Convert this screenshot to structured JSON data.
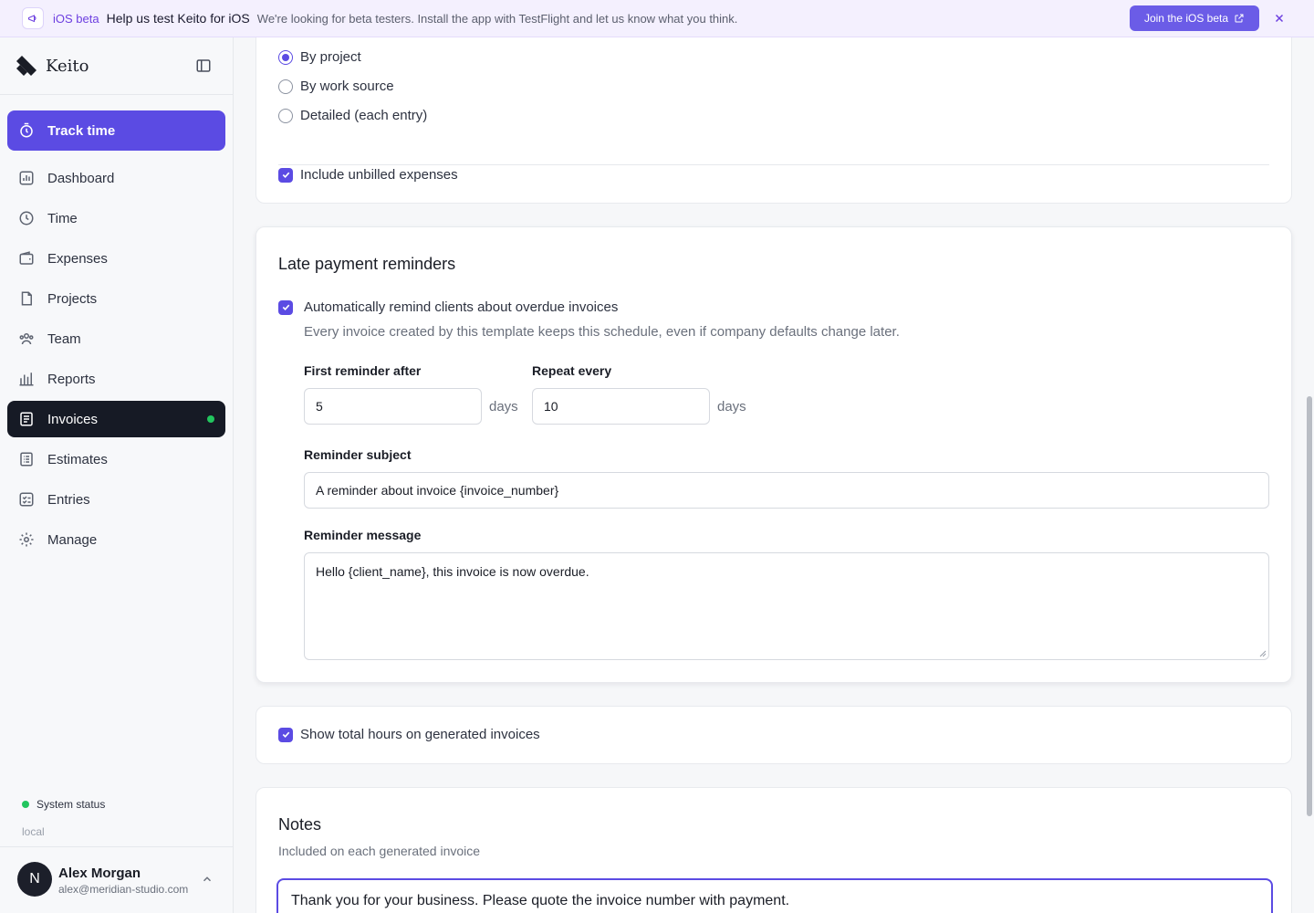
{
  "banner": {
    "tag": "iOS beta",
    "title": "Help us test Keito for iOS",
    "text": "We're looking for beta testers. Install the app with TestFlight and let us know what you think.",
    "button": "Join the iOS beta",
    "icon": "megaphone-icon"
  },
  "sidebar": {
    "brand": "Keito",
    "track_time": "Track time",
    "items": [
      {
        "label": "Dashboard",
        "icon": "dashboard-icon"
      },
      {
        "label": "Time",
        "icon": "clock-icon"
      },
      {
        "label": "Expenses",
        "icon": "wallet-icon"
      },
      {
        "label": "Projects",
        "icon": "folder-icon"
      },
      {
        "label": "Team",
        "icon": "team-icon"
      },
      {
        "label": "Reports",
        "icon": "bar-chart-icon"
      },
      {
        "label": "Invoices",
        "icon": "invoice-icon",
        "active": true
      },
      {
        "label": "Estimates",
        "icon": "estimate-icon"
      },
      {
        "label": "Entries",
        "icon": "checklist-icon"
      },
      {
        "label": "Manage",
        "icon": "gear-icon"
      }
    ],
    "system_status": "System status",
    "environment": "local",
    "user": {
      "initial": "N",
      "name": "Alex Morgan",
      "email": "alex@meridian-studio.com"
    }
  },
  "grouping": {
    "options": [
      "By project",
      "By work source",
      "Detailed (each entry)"
    ],
    "selected": "By project",
    "include_expenses": "Include unbilled expenses"
  },
  "reminders": {
    "title": "Late payment reminders",
    "auto_label": "Automatically remind clients about overdue invoices",
    "help": "Every invoice created by this template keeps this schedule, even if company defaults change later.",
    "first_label": "First reminder after",
    "first_value": "5",
    "repeat_label": "Repeat every",
    "repeat_value": "10",
    "unit": "days",
    "subject_label": "Reminder subject",
    "subject_value": "A reminder about invoice {invoice_number}",
    "message_label": "Reminder message",
    "message_value": "Hello {client_name}, this invoice is now overdue."
  },
  "hours": {
    "label": "Show total hours on generated invoices"
  },
  "notes": {
    "title": "Notes",
    "help": "Included on each generated invoice",
    "value": "Thank you for your business. Please quote the invoice number with payment."
  },
  "colors": {
    "accent": "#5b4be3",
    "active_nav": "#161a25",
    "status_green": "#22c55e"
  }
}
